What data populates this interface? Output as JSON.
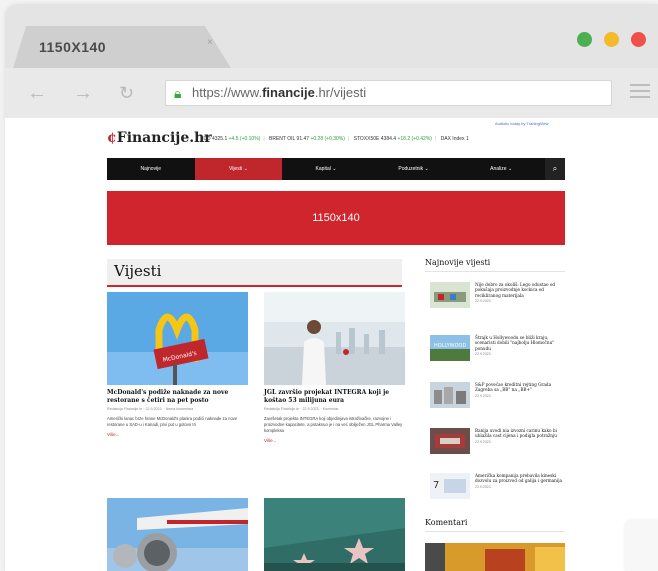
{
  "browser": {
    "tab_title": "1150X140",
    "tab_close": "×",
    "url_prefix": "https://www.",
    "url_domain": "financije",
    "url_suffix": ".hr/vijesti",
    "window_dots": {
      "green": "#4caf50",
      "yellow": "#f5b92c",
      "red": "#ef5148"
    }
  },
  "site": {
    "audit_note": "Audiotic today by TradingView",
    "logo_mark": "¢",
    "logo_text": "Financije.hr",
    "ticker": [
      {
        "name": "SDD",
        "value": "4325.1",
        "change": "+4.5 (+0.10%)"
      },
      {
        "name": "BRENT OIL",
        "value": "91.47",
        "change": "+0.28 (+0.30%)"
      },
      {
        "name": "STOXX50E",
        "value": "4384.4",
        "change": "+18.2 (+0.42%)"
      },
      {
        "name": "DAX Index",
        "value": "1",
        "change": ""
      }
    ],
    "nav": [
      "Najnovije",
      "Vijesti ⌄",
      "Kapital ⌄",
      "Poduzetnik ⌄",
      "Analize ⌄"
    ],
    "banner": "1150x140",
    "section_title": "Vijesti",
    "articles": [
      {
        "title": "McDonald's podiže naknade za nove restorane s četiri na pet posto",
        "meta": "Redakcija Financije.hr · 22.9.2023. · Nema komentara",
        "excerpt": "Američki lanac brze hrane McDonald's planira podići naknade za nove restorane u SAD-u i Kanadi, prvi put u gotovo tri",
        "more": "Više..."
      },
      {
        "title": "JGL završio projekat INTEGRA koji je koštao 53 milijuna eura",
        "meta": "Redakcija Financije.hr · 22.9.2023. · Komentar",
        "excerpt": "Završetak projekta INTEGRA koji objedinjava istraživačke, razvojne i proizvodne kapacitete, a potaknuo je i na već obilježen JGL Pharma Valley kompleksa",
        "more": "Više..."
      }
    ],
    "sidebar_title": "Najnovije vijesti",
    "sidebar": [
      {
        "title": "Nije dobro za okoliš: Lego odustao od pokušaja proizvodnje kockica od recikliranog materijala",
        "date": "22.9.2023."
      },
      {
        "title": "Štrajk u Hollywoodu se bliži kraju, scenaristi dobili \"najbolju Hlomočnu\" ponudu",
        "date": "22.9.2023."
      },
      {
        "title": "S&P povećao kreditni rejting Grada Zagreba sa „BB\" na „BB+\"",
        "date": "22.9.2023."
      },
      {
        "title": "Banija uvodi nia izvozni carinu kako bi ublažila cast cijena i podigla potražnju",
        "date": "22.9.2023."
      },
      {
        "title": "Američka kompanija prebavila kineski dozvolu za proizvod od galija i germanija",
        "date": "22.9.2023."
      }
    ],
    "comments_title": "Komentari"
  }
}
